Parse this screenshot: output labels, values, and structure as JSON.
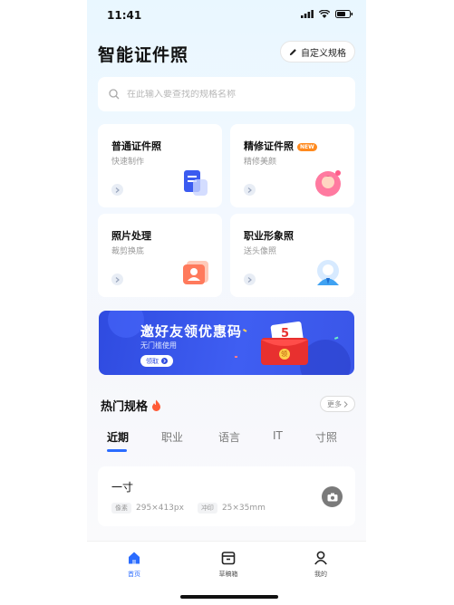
{
  "status_bar": {
    "time": "11:41"
  },
  "header": {
    "title": "智能证件照",
    "custom_button": "自定义规格"
  },
  "search": {
    "placeholder": "在此输入要查找的规格名称"
  },
  "cards": [
    {
      "title": "普通证件照",
      "subtitle": "快速制作",
      "badge": ""
    },
    {
      "title": "精修证件照",
      "subtitle": "精修美颜",
      "badge": "NEW"
    },
    {
      "title": "照片处理",
      "subtitle": "裁剪换底",
      "badge": ""
    },
    {
      "title": "职业形象照",
      "subtitle": "送头像照",
      "badge": ""
    }
  ],
  "banner": {
    "title": "邀好友领优惠码",
    "subtitle": "无门槛使用",
    "button": "领取",
    "amount": "5",
    "coupon_label": "领"
  },
  "hot": {
    "title": "热门规格",
    "more": "更多"
  },
  "tabs": [
    {
      "label": "近期",
      "active": true
    },
    {
      "label": "职业",
      "active": false
    },
    {
      "label": "语言",
      "active": false
    },
    {
      "label": "IT",
      "active": false
    },
    {
      "label": "寸照",
      "active": false
    }
  ],
  "spec_item": {
    "name": "一寸",
    "pixel_tag": "像素",
    "pixel_value": "295×413px",
    "print_tag": "冲印",
    "print_value": "25×35mm"
  },
  "bottom_nav": [
    {
      "label": "首页",
      "icon": "home-icon",
      "active": true
    },
    {
      "label": "草稿箱",
      "icon": "drafts-icon",
      "active": false
    },
    {
      "label": "我的",
      "icon": "profile-icon",
      "active": false
    }
  ],
  "colors": {
    "accent": "#2b6cff",
    "banner": "#3a56e8",
    "badge": "#ff8a1f"
  }
}
